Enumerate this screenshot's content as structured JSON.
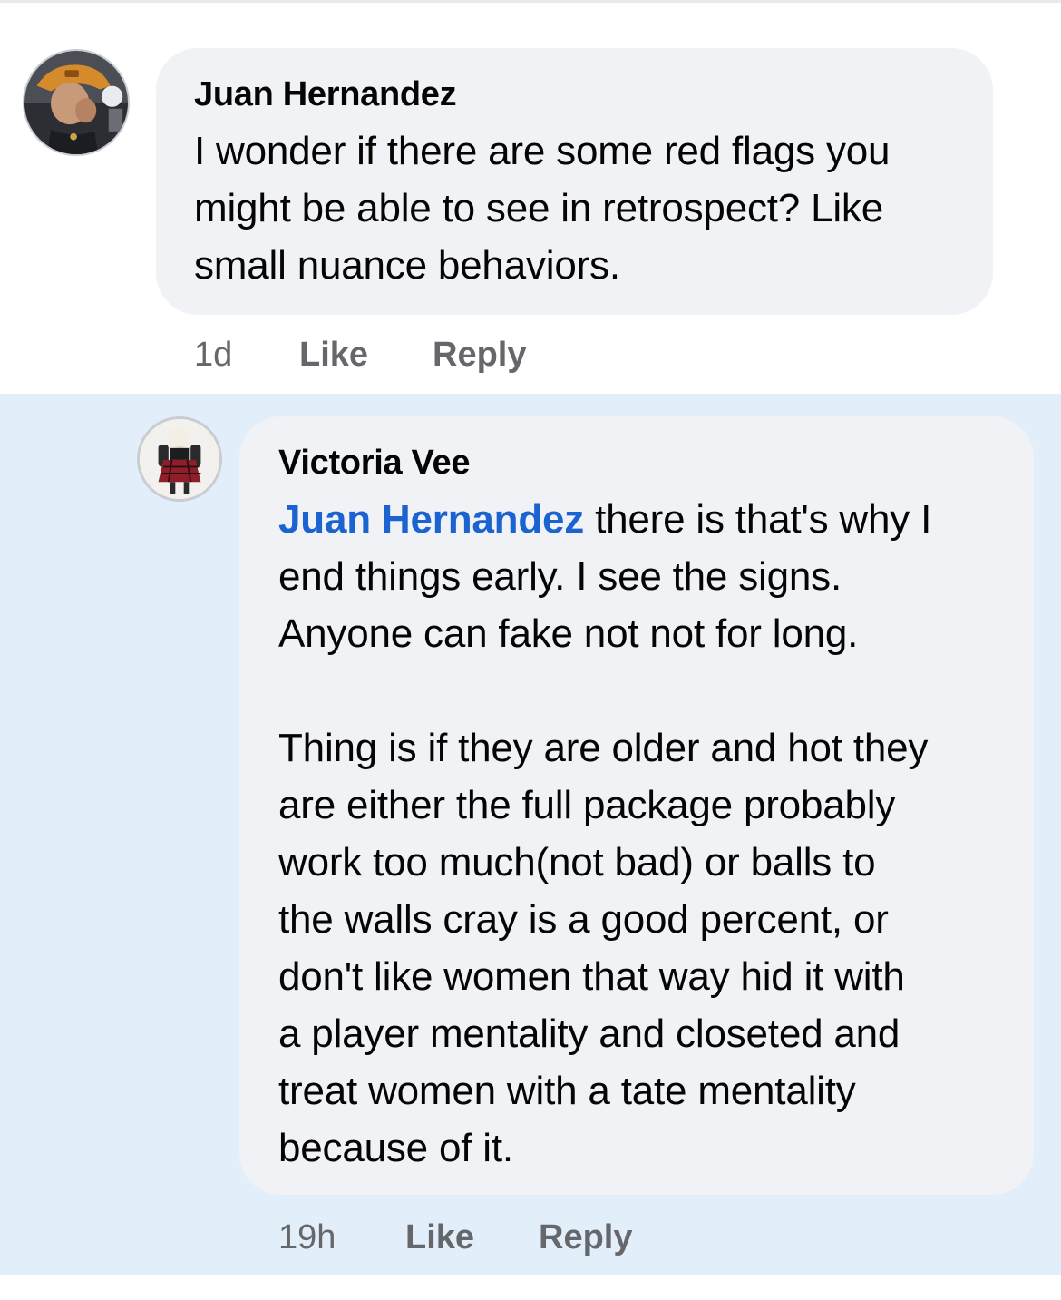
{
  "comment": {
    "author": "Juan Hernandez",
    "text": "I wonder if there are some red flags you\nmight be able to see in retrospect? Like\nsmall nuance behaviors.",
    "time": "1d",
    "like_label": "Like",
    "reply_label": "Reply"
  },
  "reply": {
    "author": "Victoria Vee",
    "mention": "Juan Hernandez",
    "text_first_line_rest": " there is that's why I",
    "text_rest": "end things early. I see the signs.\nAnyone can fake not not for long.\n\nThing is if they are older and hot they\nare either the full package probably\nwork too much(not bad) or balls to\nthe walls cray is a good percent, or\ndon't like women that way hid it with\na player mentality and closeted and\ntreat women with a tate mentality\nbecause of it.",
    "time": "19h",
    "like_label": "Like",
    "reply_label": "Reply"
  },
  "colors": {
    "mention": "#1b63d0",
    "bubble": "#f0f2f5",
    "reply_highlight": "#e3eefb",
    "meta": "#65676b"
  }
}
